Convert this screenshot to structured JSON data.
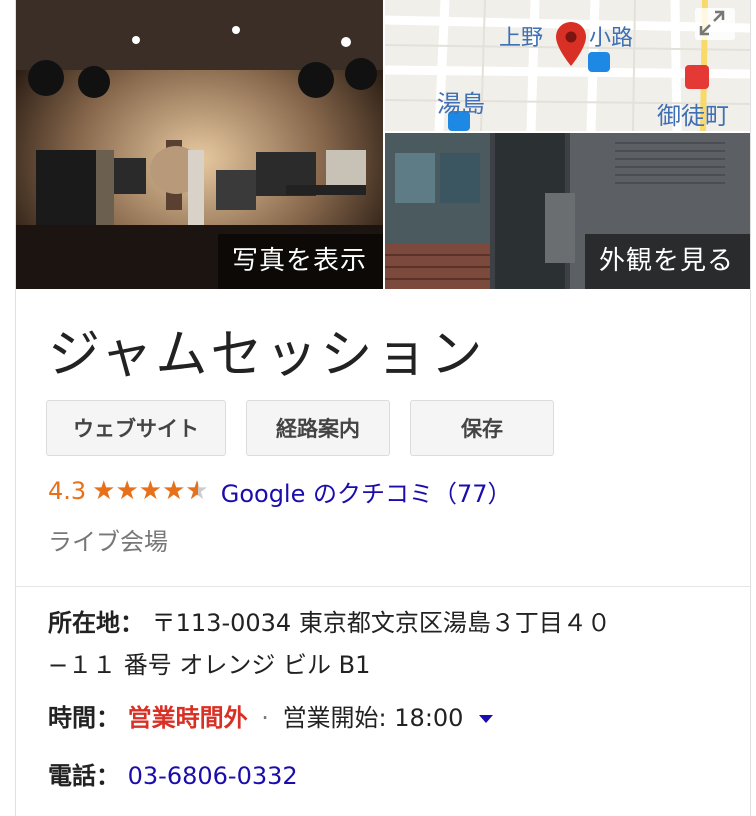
{
  "photos": {
    "main_label": "写真を表示",
    "exterior_label": "外観を見る"
  },
  "map": {
    "labels": [
      "上野",
      "小路",
      "湯島",
      "御徒町"
    ],
    "expand_icon": "expand-icon",
    "pin_color": "#d93025"
  },
  "place": {
    "name": "ジャムセッション",
    "category": "ライブ会場"
  },
  "actions": {
    "website": "ウェブサイト",
    "directions": "経路案内",
    "save": "保存"
  },
  "rating": {
    "value": "4.3",
    "stars": 4.3,
    "reviews_text": "Google のクチコミ（77）"
  },
  "info": {
    "address_label": "所在地：",
    "address_line1": "〒113-0034 東京都文京区湯島３丁目４０",
    "address_line2": "−１１ 番号 オレンジ ビル B1",
    "hours_label": "時間：",
    "hours_status": "営業時間外",
    "hours_sep": "⋅",
    "hours_open": "営業開始: 18:00",
    "phone_label": "電話：",
    "phone": "03-6806-0332"
  },
  "colors": {
    "star": "#e7711b",
    "link": "#1a0dab",
    "closed": "#d93025"
  }
}
